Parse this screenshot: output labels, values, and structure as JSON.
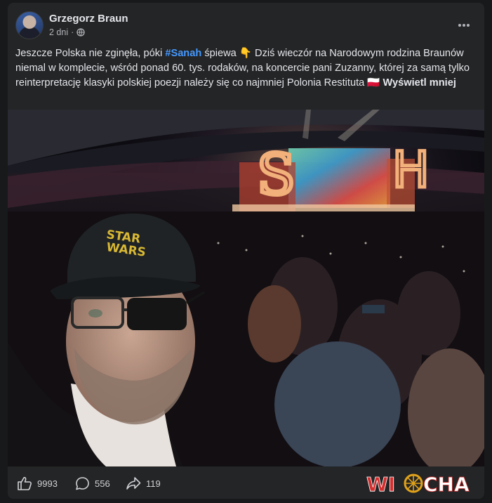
{
  "post": {
    "author": "Grzegorz Braun",
    "time": "2 dni",
    "separator": "·",
    "more_icon": "more-horizontal-icon",
    "text_before": "Jeszcze Polska nie zginęła, póki ",
    "hashtag": "#Sanah",
    "text_mid": " śpiewa ",
    "emoji_point": "👇",
    "text_after": " Dziś wieczór na Narodowym rodzina Braunów niemal w komplecie, wśród ponad 60. tys. rodaków, na koncercie pani Zuzanny, której za samą tylko reinterpretację klasyki polskiej poezji należy się co najmniej Polonia Restituta ",
    "emoji_flag": "🇵🇱",
    "see_less": "Wyświetl mniej"
  },
  "photo": {
    "cap_text_line1": "STAR",
    "cap_text_line2": "WARS",
    "stage_letter_left": "S",
    "stage_letter_right": "H"
  },
  "reactions": {
    "likes": "9993",
    "comments": "556",
    "shares": "119"
  },
  "watermark": {
    "text_left": "WI",
    "text_right": "CHA",
    "colors": {
      "red": "#d32f2f",
      "gold": "#e0a21a",
      "white": "#ffffff"
    }
  },
  "theme": {
    "card_bg": "#242526",
    "page_bg": "#18191a",
    "link": "#4599ff"
  }
}
